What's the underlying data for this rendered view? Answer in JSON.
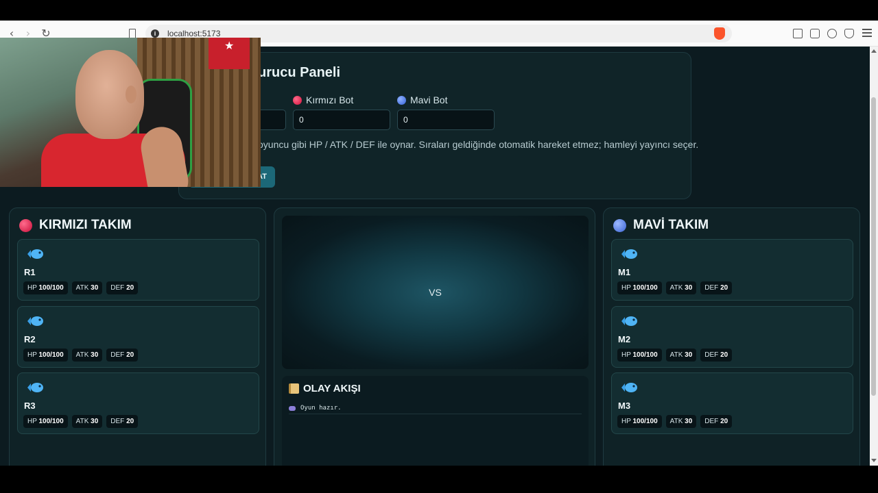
{
  "browser": {
    "url": "localhost:5173"
  },
  "admin_panel": {
    "title_fragment": "urucu Paneli",
    "red_bot_label": "Kırmızı Bot",
    "red_bot_value": "0",
    "blue_bot_label": "Mavi Bot",
    "blue_bot_value": "0",
    "note": "oyuncu gibi HP / ATK / DEF ile oynar. Sıraları geldiğinde otomatik hareket etmez; hamleyi yayıncı seçer.",
    "button_fragment": "AT"
  },
  "red_team": {
    "title": "KIRMIZI TAKIM",
    "members": [
      {
        "name": "R1",
        "hp_label": "HP",
        "hp": "100/100",
        "atk_label": "ATK",
        "atk": "30",
        "def_label": "DEF",
        "def": "20"
      },
      {
        "name": "R2",
        "hp_label": "HP",
        "hp": "100/100",
        "atk_label": "ATK",
        "atk": "30",
        "def_label": "DEF",
        "def": "20"
      },
      {
        "name": "R3",
        "hp_label": "HP",
        "hp": "100/100",
        "atk_label": "ATK",
        "atk": "30",
        "def_label": "DEF",
        "def": "20"
      }
    ]
  },
  "blue_team": {
    "title": "MAVİ TAKIM",
    "members": [
      {
        "name": "M1",
        "hp_label": "HP",
        "hp": "100/100",
        "atk_label": "ATK",
        "atk": "30",
        "def_label": "DEF",
        "def": "20"
      },
      {
        "name": "M2",
        "hp_label": "HP",
        "hp": "100/100",
        "atk_label": "ATK",
        "atk": "30",
        "def_label": "DEF",
        "def": "20"
      },
      {
        "name": "M3",
        "hp_label": "HP",
        "hp": "100/100",
        "atk_label": "ATK",
        "atk": "30",
        "def_label": "DEF",
        "def": "20"
      }
    ]
  },
  "arena": {
    "vs_text": "VS"
  },
  "event_log": {
    "title": "OLAY AKIŞI",
    "entries": [
      "Oyun hazır."
    ]
  },
  "colors": {
    "red_team": "#d1103c",
    "blue_team": "#3561d6",
    "background": "#0c1b20"
  },
  "icons": [
    "fish-icon",
    "scroll-icon",
    "gamepad-icon",
    "brave-icon"
  ]
}
